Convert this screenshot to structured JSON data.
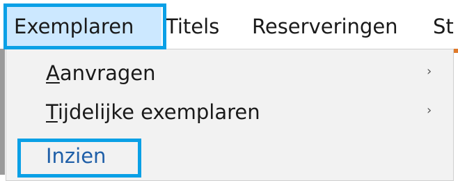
{
  "menubar": {
    "items": [
      {
        "label": "Exemplaren"
      },
      {
        "label": "Titels"
      },
      {
        "label": "Reserveringen"
      },
      {
        "label": "St"
      }
    ]
  },
  "dropdown": {
    "items": [
      {
        "accel": "A",
        "rest": "anvragen",
        "arrow": "›"
      },
      {
        "accel": "T",
        "rest": "ijdelijke exemplaren",
        "arrow": "›"
      },
      {
        "label": "Inzien"
      }
    ]
  },
  "colors": {
    "highlight_border": "#0aa0e6",
    "active_menu_bg": "#cce8ff",
    "accent": "#e07a2a",
    "inzien_text": "#1f5fa8"
  }
}
